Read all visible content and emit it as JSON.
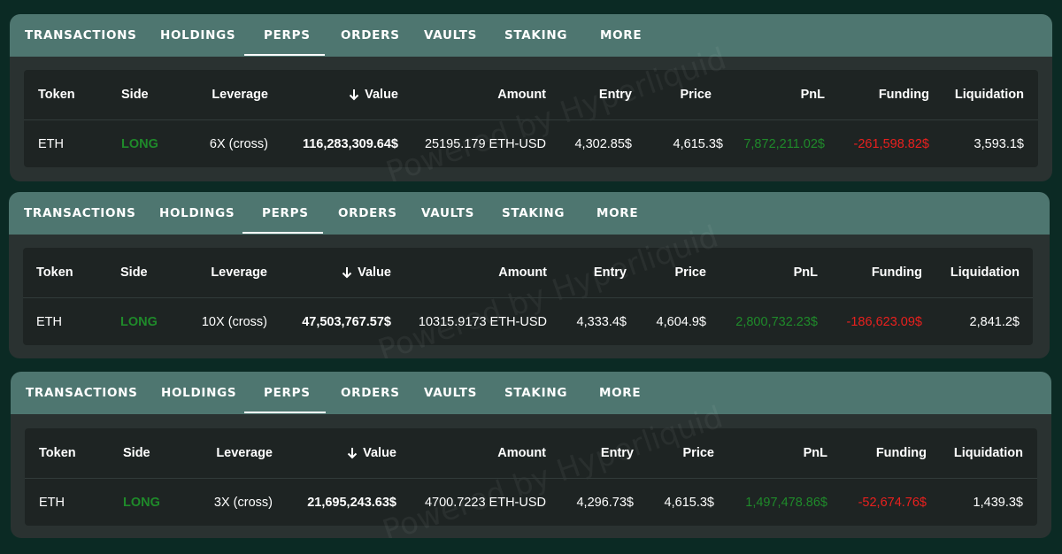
{
  "tabs": [
    "TRANSACTIONS",
    "HOLDINGS",
    "PERPS",
    "ORDERS",
    "VAULTS",
    "STAKING",
    "MORE"
  ],
  "active_tab": "PERPS",
  "watermark": "Powered by Hyperliquid",
  "columns": [
    "Token",
    "Side",
    "Leverage",
    "Value",
    "Amount",
    "Entry",
    "Price",
    "PnL",
    "Funding",
    "Liquidation"
  ],
  "sort_icon": "arrow-down-icon",
  "colors": {
    "long": "#1f8a2a",
    "positive": "#1f8a2a",
    "negative": "#e8201e",
    "tabbar": "#4e7670"
  },
  "panels": [
    {
      "rows": [
        {
          "token": "ETH",
          "side": "LONG",
          "leverage": "6X (cross)",
          "value": "116,283,309.64$",
          "amount": "25195.179 ETH-USD",
          "entry": "4,302.85$",
          "price": "4,615.3$",
          "pnl": "7,872,211.02$",
          "funding": "-261,598.82$",
          "liquidation": "3,593.1$"
        }
      ]
    },
    {
      "rows": [
        {
          "token": "ETH",
          "side": "LONG",
          "leverage": "10X (cross)",
          "value": "47,503,767.57$",
          "amount": "10315.9173 ETH-USD",
          "entry": "4,333.4$",
          "price": "4,604.9$",
          "pnl": "2,800,732.23$",
          "funding": "-186,623.09$",
          "liquidation": "2,841.2$"
        }
      ]
    },
    {
      "rows": [
        {
          "token": "ETH",
          "side": "LONG",
          "leverage": "3X (cross)",
          "value": "21,695,243.63$",
          "amount": "4700.7223 ETH-USD",
          "entry": "4,296.73$",
          "price": "4,615.3$",
          "pnl": "1,497,478.86$",
          "funding": "-52,674.76$",
          "liquidation": "1,439.3$"
        }
      ]
    }
  ]
}
